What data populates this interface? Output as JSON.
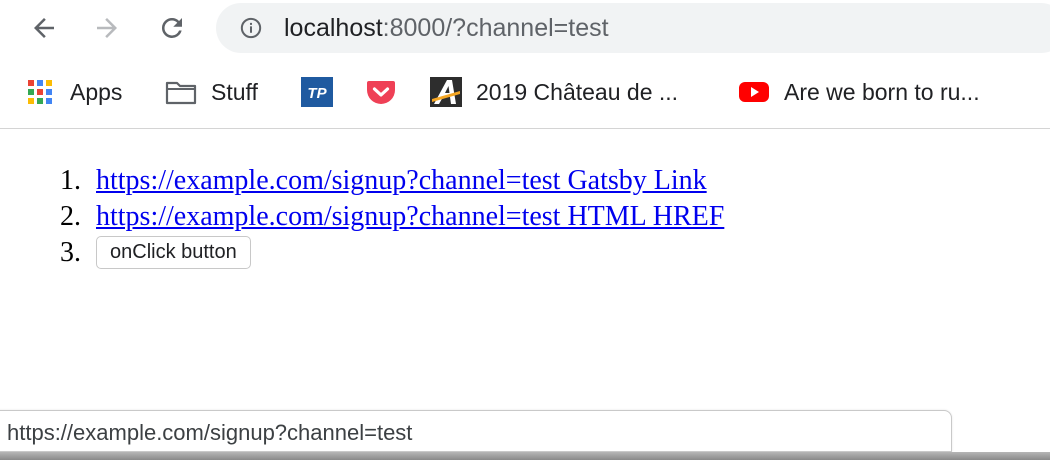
{
  "toolbar": {
    "back_icon": "back-arrow-icon",
    "forward_icon": "forward-arrow-icon",
    "reload_icon": "reload-icon",
    "url_host": "localhost",
    "url_rest": ":8000/?channel=test",
    "info_icon": "info-icon"
  },
  "bookmarks": [
    {
      "icon": "apps-grid-icon",
      "label": "Apps"
    },
    {
      "icon": "folder-icon",
      "label": "Stuff"
    },
    {
      "icon": "tp-logo-icon",
      "label": ""
    },
    {
      "icon": "pocket-icon",
      "label": ""
    },
    {
      "icon": "a-logo-icon",
      "label": "2019 Château de ..."
    },
    {
      "icon": "youtube-icon",
      "label": "Are we born to ru..."
    }
  ],
  "tp_logo_text": "TP",
  "content": {
    "items": [
      {
        "number": "1.",
        "text": "https://example.com/signup?channel=test Gatsby Link"
      },
      {
        "number": "2.",
        "text": "https://example.com/signup?channel=test HTML HREF"
      },
      {
        "number": "3.",
        "button_label": "onClick button"
      }
    ]
  },
  "status_bar": {
    "url": "https://example.com/signup?channel=test"
  },
  "colors": {
    "link": "#0000ee",
    "omnibox_bg": "#f1f3f4",
    "pocket_red": "#ef4056",
    "youtube_red": "#ff0000",
    "tp_blue": "#1f5aa0"
  }
}
